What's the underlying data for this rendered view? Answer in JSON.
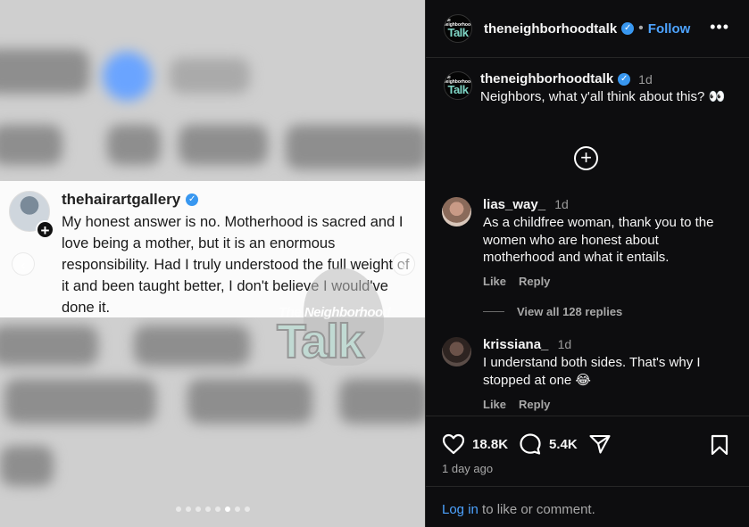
{
  "post": {
    "account": "theneighborhoodtalk",
    "follow_label": "Follow",
    "separator": "•",
    "more_label": "•••",
    "logo_small": "The Neighborhood",
    "logo_big": "Talk"
  },
  "media": {
    "quote_user": "thehairartgallery",
    "quote_text": "My honest answer is no. Motherhood is sacred and I love being a mother, but it is an enormous responsibility. Had I truly understood the full weight of it and been taught better, I don't believe I would've done it.",
    "watermark_small": "The Neighborhood",
    "watermark_big": "Talk",
    "prev_label": "‹",
    "next_label": "›",
    "slide_count": 8,
    "active_slide": 6
  },
  "caption": {
    "handle": "theneighborhoodtalk",
    "time": "1d",
    "text": "Neighbors, what y'all think about this? 👀"
  },
  "comments": [
    {
      "user": "lias_way_",
      "time": "1d",
      "text": "As a childfree woman, thank you to the women who are honest about motherhood and what it entails.",
      "like_label": "Like",
      "reply_label": "Reply"
    },
    {
      "user": "krissiana_",
      "time": "1d",
      "text": "I understand both sides. That's why I stopped at one 😂",
      "like_label": "Like",
      "reply_label": "Reply"
    }
  ],
  "view_replies": "View all 128 replies",
  "stats": {
    "likes": "18.8K",
    "comments": "5.4K"
  },
  "time_ago": "1 day ago",
  "login": {
    "link": "Log in",
    "rest": " to like or comment."
  },
  "colors": {
    "accent": "#4da3ff",
    "verified": "#3897f0",
    "panel_bg": "#0d0d0f"
  }
}
